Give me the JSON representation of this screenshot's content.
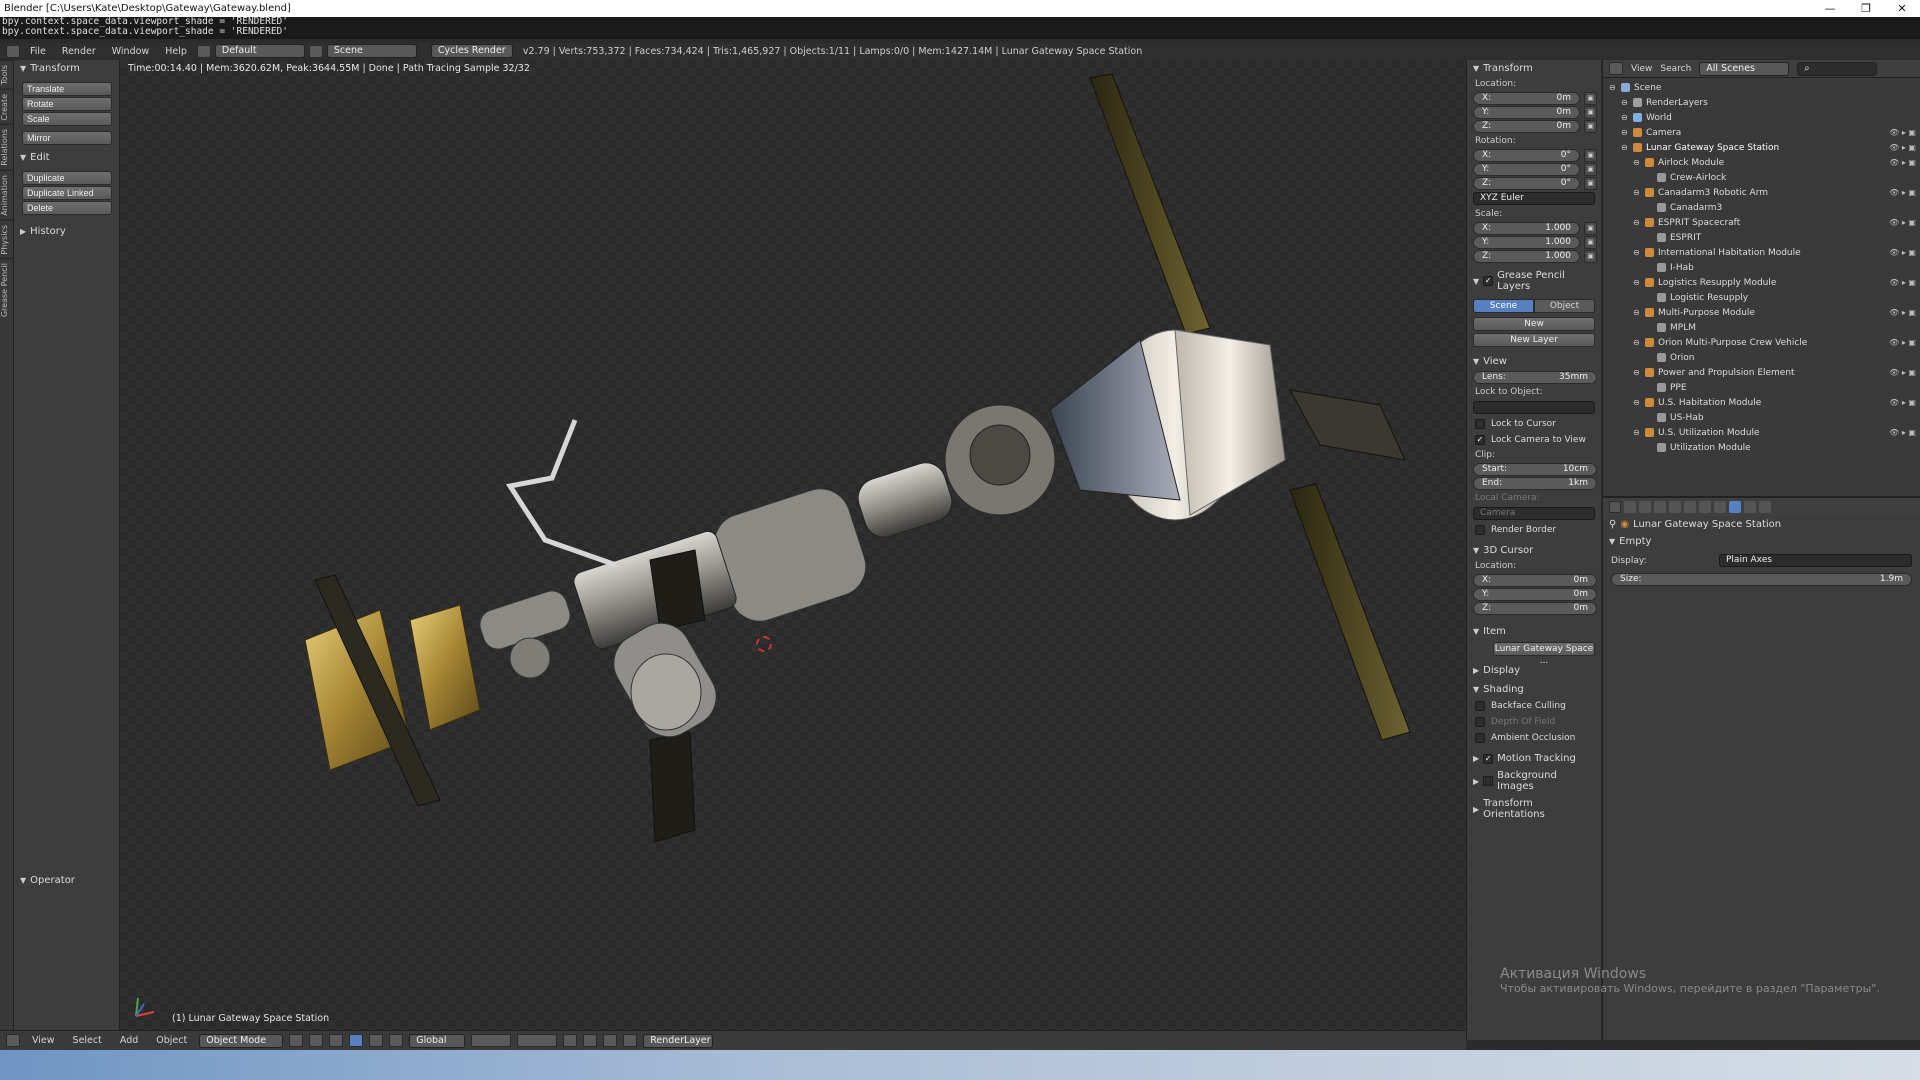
{
  "window": {
    "title": "Blender [C:\\Users\\Kate\\Desktop\\Gateway\\Gateway.blend]"
  },
  "console": {
    "line1": "bpy.context.space_data.viewport_shade = 'RENDERED'",
    "line2": "bpy.context.space_data.viewport_shade = 'RENDERED'"
  },
  "info_header": {
    "menus": [
      "File",
      "Render",
      "Window",
      "Help"
    ],
    "layout": "Default",
    "scene": "Scene",
    "engine": "Cycles Render",
    "stats": "v2.79 | Verts:753,372 | Faces:734,424 | Tris:1,465,927 | Objects:1/11 | Lamps:0/0 | Mem:1427.14M | Lunar Gateway Space Station"
  },
  "left_tabs": [
    "Tools",
    "Create",
    "Relations",
    "Animation",
    "Physics",
    "Grease Pencil"
  ],
  "toolshelf": {
    "transform_header": "Transform",
    "transform_buttons": [
      "Translate",
      "Rotate",
      "Scale"
    ],
    "mirror": "Mirror",
    "edit_header": "Edit",
    "edit_buttons": [
      "Duplicate",
      "Duplicate Linked",
      "Delete"
    ],
    "history_header": "History",
    "operator_header": "Operator"
  },
  "viewport": {
    "render_status": "Time:00:14.40 | Mem:3620.62M, Peak:3644.55M | Done | Path Tracing Sample 32/32",
    "object_label": "(1) Lunar Gateway Space Station"
  },
  "npanel": {
    "transform_header": "Transform",
    "location_label": "Location:",
    "location": [
      {
        "axis": "X:",
        "value": "0m"
      },
      {
        "axis": "Y:",
        "value": "0m"
      },
      {
        "axis": "Z:",
        "value": "0m"
      }
    ],
    "rotation_label": "Rotation:",
    "rotation": [
      {
        "axis": "X:",
        "value": "0°"
      },
      {
        "axis": "Y:",
        "value": "0°"
      },
      {
        "axis": "Z:",
        "value": "0°"
      }
    ],
    "rotation_mode": "XYZ Euler",
    "scale_label": "Scale:",
    "scale": [
      {
        "axis": "X:",
        "value": "1.000"
      },
      {
        "axis": "Y:",
        "value": "1.000"
      },
      {
        "axis": "Z:",
        "value": "1.000"
      }
    ],
    "grease_header": "Grease Pencil Layers",
    "gp_scene": "Scene",
    "gp_object": "Object",
    "gp_new": "New",
    "gp_new_layer": "New Layer",
    "view_header": "View",
    "lens_label": "Lens:",
    "lens_value": "35mm",
    "lock_to_object": "Lock to Object:",
    "lock_to_cursor": "Lock to Cursor",
    "lock_camera": "Lock Camera to View",
    "clip_label": "Clip:",
    "clip_start_label": "Start:",
    "clip_start": "10cm",
    "clip_end_label": "End:",
    "clip_end": "1km",
    "local_camera": "Local Camera:",
    "camera": "Camera",
    "render_border": "Render Border",
    "cursor_header": "3D Cursor",
    "cursor_location": "Location:",
    "cursor": [
      {
        "axis": "X:",
        "value": "0m"
      },
      {
        "axis": "Y:",
        "value": "0m"
      },
      {
        "axis": "Z:",
        "value": "0m"
      }
    ],
    "item_header": "Item",
    "item_name": "Lunar Gateway Space ...",
    "display_header": "Display",
    "shading_header": "Shading",
    "backface": "Backface Culling",
    "dof": "Depth Of Field",
    "ao": "Ambient Occlusion",
    "motion_tracking": "Motion Tracking",
    "background_images": "Background Images",
    "transform_orientations": "Transform Orientations"
  },
  "outliner": {
    "view": "View",
    "search": "Search",
    "filter": "All Scenes",
    "rows": [
      {
        "label": "Scene",
        "indent": 0,
        "color": "#8aa9d6"
      },
      {
        "label": "RenderLayers",
        "indent": 1,
        "color": "#a0a0a0"
      },
      {
        "label": "World",
        "indent": 1,
        "color": "#7fb0e0"
      },
      {
        "label": "Camera",
        "indent": 1,
        "color": "#d08a3c"
      },
      {
        "label": "Lunar Gateway Space Station",
        "indent": 1,
        "color": "#d08a3c"
      },
      {
        "label": "Airlock Module",
        "indent": 2,
        "color": "#d08a3c"
      },
      {
        "label": "Crew-Airlock",
        "indent": 3,
        "color": "#9a9a9a"
      },
      {
        "label": "Canadarm3 Robotic Arm",
        "indent": 2,
        "color": "#d08a3c"
      },
      {
        "label": "Canadarm3",
        "indent": 3,
        "color": "#9a9a9a"
      },
      {
        "label": "ESPRIT Spacecraft",
        "indent": 2,
        "color": "#d08a3c"
      },
      {
        "label": "ESPRIT",
        "indent": 3,
        "color": "#9a9a9a"
      },
      {
        "label": "International Habitation Module",
        "indent": 2,
        "color": "#d08a3c"
      },
      {
        "label": "I-Hab",
        "indent": 3,
        "color": "#9a9a9a"
      },
      {
        "label": "Logistics Resupply Module",
        "indent": 2,
        "color": "#d08a3c"
      },
      {
        "label": "Logistic Resupply",
        "indent": 3,
        "color": "#9a9a9a"
      },
      {
        "label": "Multi-Purpose Module",
        "indent": 2,
        "color": "#d08a3c"
      },
      {
        "label": "MPLM",
        "indent": 3,
        "color": "#9a9a9a"
      },
      {
        "label": "Orion Multi-Purpose Crew Vehicle",
        "indent": 2,
        "color": "#d08a3c"
      },
      {
        "label": "Orion",
        "indent": 3,
        "color": "#9a9a9a"
      },
      {
        "label": "Power and Propulsion Element",
        "indent": 2,
        "color": "#d08a3c"
      },
      {
        "label": "PPE",
        "indent": 3,
        "color": "#9a9a9a"
      },
      {
        "label": "U.S. Habitation Module",
        "indent": 2,
        "color": "#d08a3c"
      },
      {
        "label": "US-Hab",
        "indent": 3,
        "color": "#9a9a9a"
      },
      {
        "label": "U.S. Utilization Module",
        "indent": 2,
        "color": "#d08a3c"
      },
      {
        "label": "Utilization Module",
        "indent": 3,
        "color": "#9a9a9a"
      }
    ]
  },
  "properties": {
    "breadcrumb": "Lunar Gateway Space Station",
    "empty_header": "Empty",
    "display_label": "Display:",
    "display_value": "Plain Axes",
    "size_label": "Size:",
    "size_value": "1.9m"
  },
  "bottom_bar": {
    "menus": [
      "View",
      "Select",
      "Add",
      "Object"
    ],
    "mode": "Object Mode",
    "orientation": "Global",
    "render_layer": "RenderLayer"
  },
  "watermark": {
    "line1": "Активация Windows",
    "line2": "Чтобы активировать Windows, перейдите в раздел \"Параметры\"."
  }
}
